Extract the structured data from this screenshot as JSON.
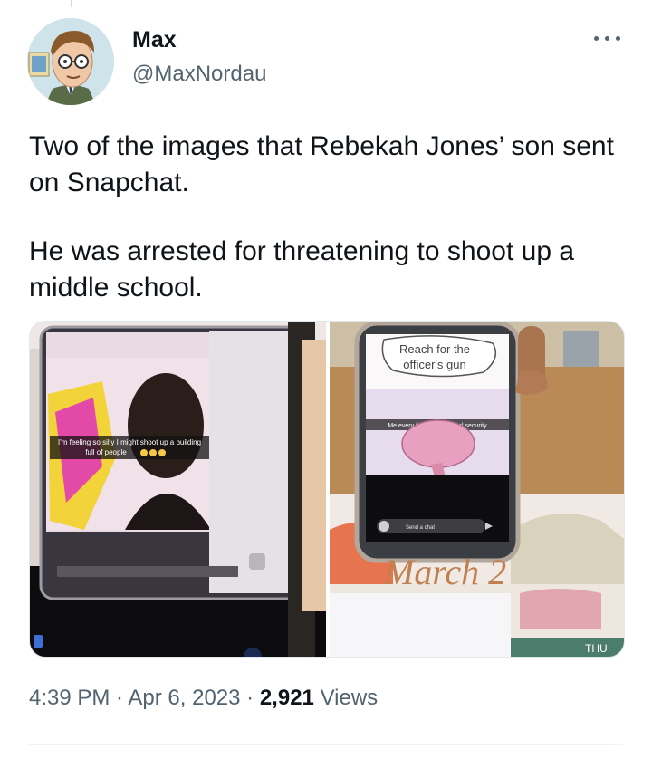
{
  "author": {
    "name": "Max",
    "handle": "@MaxNordau",
    "avatar_icon": "cartoon-character-avatar"
  },
  "tweet": {
    "paragraphs": [
      "Two of the images that Rebekah Jones’ son sent on Snapchat.",
      "He was arrested for threatening to shoot up a middle school."
    ]
  },
  "media": {
    "left_caption_line1": "I'm feeling so silly I might shoot up a building",
    "left_caption_line2": "full of people",
    "right_speech_line1": "Reach for the",
    "right_speech_line2": "officer's gun",
    "right_caption": "Me every time I see school security",
    "right_send_chat": "Send a chat",
    "right_march_text": "March 2",
    "right_thu_text": "THU"
  },
  "meta": {
    "time": "4:39 PM",
    "separator": " · ",
    "date": "Apr 6, 2023",
    "views_count": "2,921",
    "views_label": "Views"
  },
  "colors": {
    "text": "#0f1419",
    "secondary": "#536471",
    "border": "#e1e8ed"
  }
}
